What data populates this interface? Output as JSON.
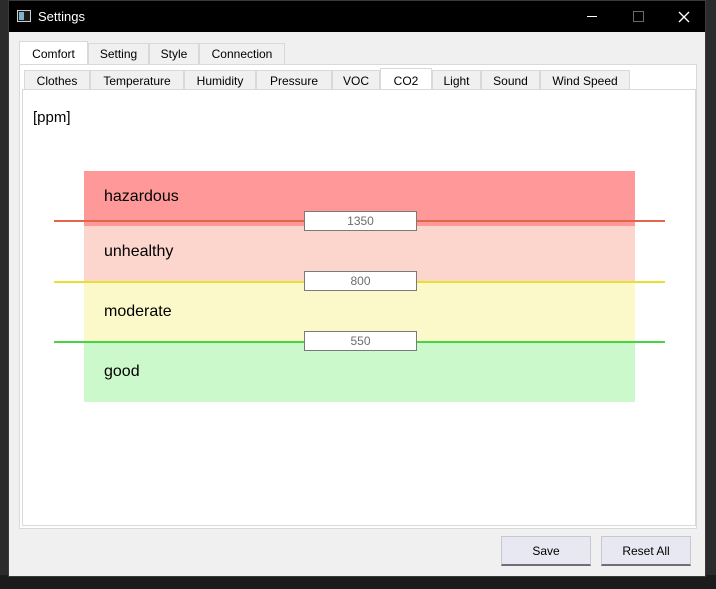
{
  "window": {
    "title": "Settings",
    "icon": "app-window-icon"
  },
  "main_tabs": [
    {
      "label": "Comfort",
      "active": true
    },
    {
      "label": "Setting",
      "active": false
    },
    {
      "label": "Style",
      "active": false
    },
    {
      "label": "Connection",
      "active": false
    }
  ],
  "sub_tabs": [
    {
      "label": "Clothes",
      "active": false
    },
    {
      "label": "Temperature",
      "active": false
    },
    {
      "label": "Humidity",
      "active": false
    },
    {
      "label": "Pressure",
      "active": false
    },
    {
      "label": "VOC",
      "active": false
    },
    {
      "label": "CO2",
      "active": true
    },
    {
      "label": "Light",
      "active": false
    },
    {
      "label": "Sound",
      "active": false
    },
    {
      "label": "Wind Speed",
      "active": false
    }
  ],
  "co2_panel": {
    "unit": "[ppm]",
    "zones": [
      {
        "label": "hazardous",
        "color": "#ff9999"
      },
      {
        "label": "unhealthy",
        "color": "#fcd5cc"
      },
      {
        "label": "moderate",
        "color": "#fbf9c9"
      },
      {
        "label": "good",
        "color": "#ccf9cc"
      }
    ],
    "thresholds": [
      {
        "value": "1350",
        "line_color": "#e0654a"
      },
      {
        "value": "800",
        "line_color": "#e8e030"
      },
      {
        "value": "550",
        "line_color": "#44d444"
      }
    ]
  },
  "footer": {
    "save_label": "Save",
    "reset_label": "Reset All"
  }
}
